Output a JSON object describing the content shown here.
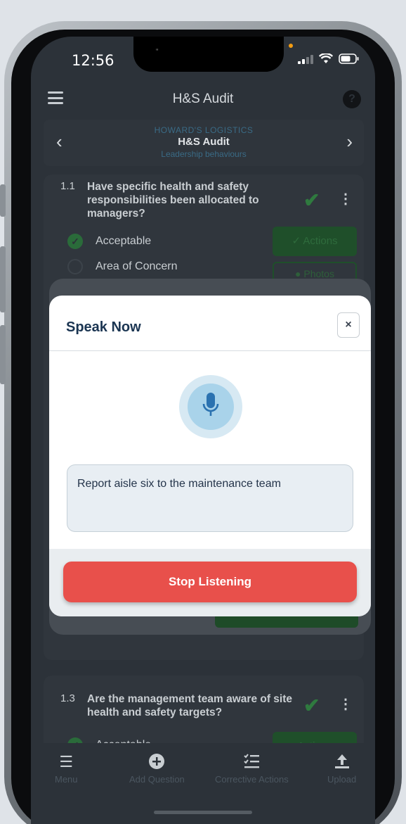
{
  "status_bar": {
    "time": "12:56"
  },
  "header": {
    "title": "H&S Audit",
    "help_symbol": "?"
  },
  "context": {
    "company": "HOWARD'S LOGISTICS",
    "audit": "H&S Audit",
    "section": "Leadership behaviours",
    "prev_symbol": "‹",
    "next_symbol": "›"
  },
  "questions": [
    {
      "number": "1.1",
      "text": "Have specific health and safety responsibilities been allocated to managers?",
      "options": [
        "Acceptable",
        "Area of Concern"
      ],
      "actions_label": "Actions",
      "photos_label": "Photos"
    },
    {
      "number": "1.3",
      "text": "Are the management team aware of site health and safety targets?",
      "options": [
        "Acceptable"
      ],
      "actions_label": "Actions"
    }
  ],
  "modal": {
    "title": "Speak Now",
    "close_symbol": "×",
    "transcript": "Report aisle six to the maintenance team",
    "stop_label": "Stop Listening"
  },
  "bottom_nav": {
    "items": [
      {
        "label": "Menu",
        "icon": "menu-icon"
      },
      {
        "label": "Add Question",
        "icon": "plus-circle-icon"
      },
      {
        "label": "Corrective Actions",
        "icon": "checklist-icon"
      },
      {
        "label": "Upload",
        "icon": "upload-icon"
      }
    ]
  },
  "colors": {
    "accent_red": "#e8504b",
    "green": "#2f7a3f",
    "navy": "#1b3552"
  }
}
